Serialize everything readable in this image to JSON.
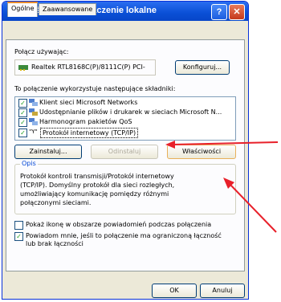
{
  "window": {
    "title": "Właściwości: Połączenie lokalne"
  },
  "title_buttons": {
    "help": "?",
    "close": "✕"
  },
  "tabs": [
    {
      "label": "Ogólne"
    },
    {
      "label": "Zaawansowane"
    }
  ],
  "connect_using": {
    "label": "Połącz używając:",
    "adapter": "Realtek RTL8168C(P)/8111C(P) PCI-",
    "configure_button": "Konfiguruj..."
  },
  "components": {
    "label": "To połączenie wykorzystuje następujące składniki:",
    "items": [
      {
        "label": "Klient sieci Microsoft Networks",
        "checked": true
      },
      {
        "label": "Udostępnianie plików i drukarek w sieciach Microsoft N...",
        "checked": true
      },
      {
        "label": "Harmonogram pakietów QoS",
        "checked": true
      },
      {
        "prefix": "\"Y\"",
        "label": "Protokół internetowy (TCP/IP)",
        "checked": true
      }
    ]
  },
  "buttons": {
    "install": "Zainstaluj...",
    "uninstall": "Odinstaluj",
    "properties": "Właściwości"
  },
  "description": {
    "title": "Opis",
    "text": "Protokół kontroli transmisji/Protokół internetowy (TCP/IP). Domyślny protokół dla sieci rozległych, umożliwiający komunikację pomiędzy różnymi połączonymi sieciami."
  },
  "options": {
    "show_icon": {
      "label": "Pokaż ikonę w obszarze powiadomień podczas połączenia",
      "checked": false
    },
    "notify": {
      "label": "Powiadom mnie, jeśli to połączenie ma ograniczoną łączność lub brak łączności",
      "checked": true
    }
  },
  "footer": {
    "ok": "OK",
    "cancel": "Anuluj"
  },
  "check_mark": "✓",
  "colors": {
    "arrow": "#e8202a",
    "title_bar": "#0a4fd6"
  }
}
